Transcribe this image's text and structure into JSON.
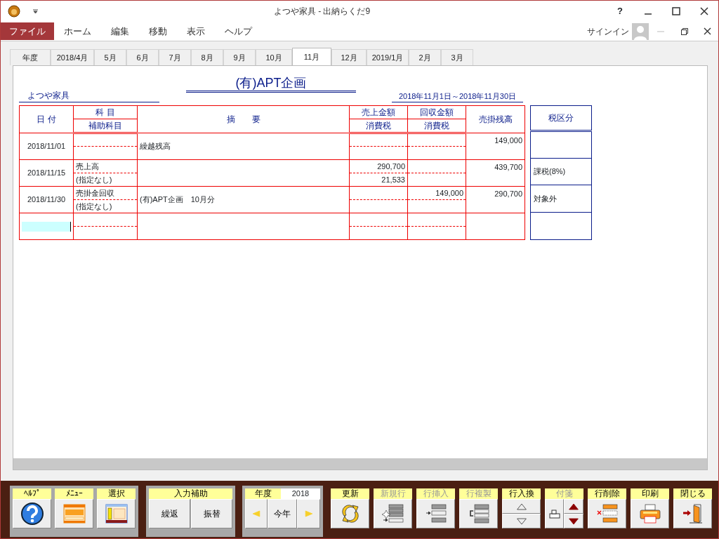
{
  "window": {
    "title": "よつや家具 - 出納らくだ9",
    "help": "?"
  },
  "menu": [
    {
      "label": "ファイル",
      "kind": "file"
    },
    {
      "label": "ホーム",
      "kind": "tab"
    },
    {
      "label": "編集",
      "kind": "tab"
    },
    {
      "label": "移動",
      "kind": "tab"
    },
    {
      "label": "表示",
      "kind": "tab"
    },
    {
      "label": "ヘルプ",
      "kind": "tab"
    }
  ],
  "signin": "サインイン",
  "month_tabs": [
    {
      "label": "年度",
      "selected": false
    },
    {
      "label": "2018/4月",
      "selected": false
    },
    {
      "label": "5月",
      "selected": false
    },
    {
      "label": "6月",
      "selected": false
    },
    {
      "label": "7月",
      "selected": false
    },
    {
      "label": "8月",
      "selected": false
    },
    {
      "label": "9月",
      "selected": false
    },
    {
      "label": "10月",
      "selected": false
    },
    {
      "label": "11月",
      "selected": true
    },
    {
      "label": "12月",
      "selected": false
    },
    {
      "label": "2019/1月",
      "selected": false
    },
    {
      "label": "2月",
      "selected": false
    },
    {
      "label": "3月",
      "selected": false
    }
  ],
  "report": {
    "company": "よつや家具",
    "title": "(有)APT企画",
    "period": "2018年11月1日～2018年11月30日"
  },
  "headers": {
    "date": "日 付",
    "subject": "科 目",
    "sub_subject": "補助科目",
    "summary": "摘　　要",
    "sales": "売上金額",
    "sales_tax": "消費税",
    "collected": "回収金額",
    "collected_tax": "消費税",
    "balance": "売掛残高",
    "tax_class": "税区分"
  },
  "rows": [
    {
      "kind": "entry",
      "date": "2018/11/01",
      "summary": "繰越残高",
      "balance": "149,000"
    },
    {
      "kind": "entry",
      "date": "2018/11/15",
      "subject": "売上高",
      "sub_subject": "(指定なし)",
      "sales": "290,700",
      "sales_tax": "21,533",
      "balance": "439,700",
      "tax_class": "課税(8%)"
    },
    {
      "kind": "entry",
      "date": "2018/11/30",
      "subject": "売掛金回収",
      "sub_subject": "(指定なし)",
      "summary": "(有)APT企画　10月分",
      "collected": "149,000",
      "balance": "290,700",
      "tax_class": "対象外"
    },
    {
      "kind": "input"
    }
  ],
  "toolbar": {
    "panel_units": [
      {
        "label": "ﾍﾙﾌﾟ",
        "kind": "help",
        "disabled": false
      },
      {
        "label": "ﾒﾆｭｰ",
        "kind": "menu",
        "disabled": false
      },
      {
        "label": "選択",
        "kind": "select",
        "disabled": false
      }
    ],
    "assist": {
      "label": "入力補助",
      "buttons": [
        "繰返",
        "振替"
      ]
    },
    "year": {
      "label": "年度",
      "value": "2018",
      "today": "今年"
    },
    "units": [
      {
        "label": "更新",
        "kind": "refresh",
        "disabled": false
      },
      {
        "label": "新規行",
        "kind": "newrow",
        "disabled": true
      },
      {
        "label": "行挿入",
        "kind": "insert",
        "disabled": true
      },
      {
        "label": "行複製",
        "kind": "copy",
        "disabled": true
      },
      {
        "label": "行入換",
        "kind": "updown",
        "disabled": false
      },
      {
        "label": "付箋",
        "kind": "note",
        "disabled": true
      },
      {
        "label": "行削除",
        "kind": "delete",
        "disabled": false
      },
      {
        "label": "印刷",
        "kind": "print",
        "disabled": false
      },
      {
        "label": "閉じる",
        "kind": "exit",
        "disabled": false
      }
    ]
  }
}
